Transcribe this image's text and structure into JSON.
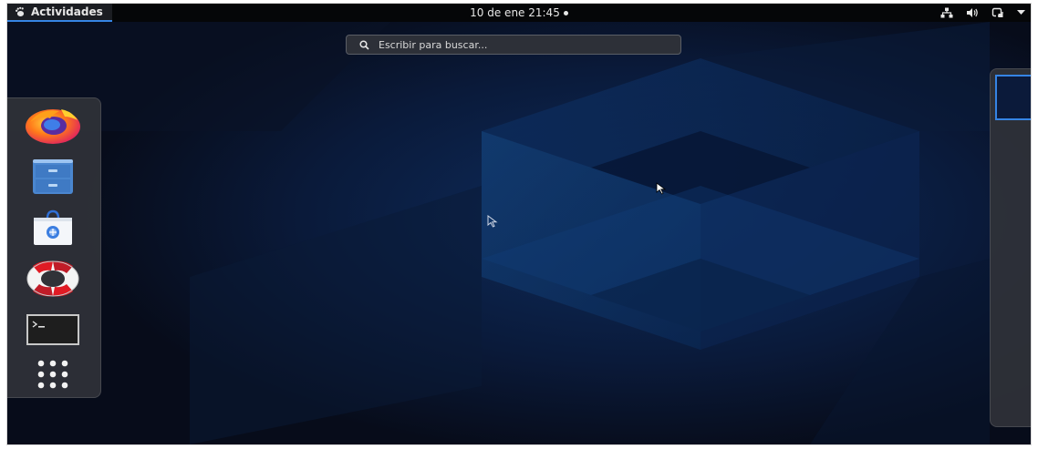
{
  "topbar": {
    "activities_label": "Actividades",
    "clock_text": "10 de ene  21:45"
  },
  "search": {
    "placeholder": "Escribir para buscar..."
  },
  "dash": {
    "apps": [
      {
        "name": "Firefox",
        "icon": "firefox-icon"
      },
      {
        "name": "Archivos",
        "icon": "file-cabinet-icon"
      },
      {
        "name": "Software",
        "icon": "shopping-bag-icon"
      },
      {
        "name": "Ayuda",
        "icon": "lifebuoy-icon"
      },
      {
        "name": "Terminal",
        "icon": "terminal-icon"
      },
      {
        "name": "Mostrar aplicaciones",
        "icon": "app-grid-icon"
      }
    ]
  },
  "colors": {
    "accent": "#3584e4",
    "topbar_bg": "#050608",
    "wallpaper_dark": "#0a1224",
    "wallpaper_blue": "#0f3a78"
  },
  "status_icons": [
    "network-icon",
    "volume-icon",
    "power-icon",
    "chevron-down-icon"
  ]
}
